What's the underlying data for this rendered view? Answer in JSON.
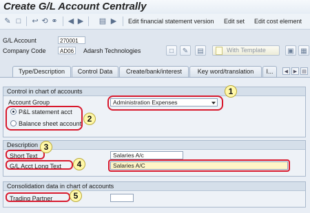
{
  "window": {
    "title": "Create G/L Account Centrally"
  },
  "toolbar": {
    "edit_fs_version": "Edit financial statement version",
    "edit_set": "Edit set",
    "edit_cost_element": "Edit cost element"
  },
  "header": {
    "gl_account_label": "G/L Account",
    "gl_account_value": "270001",
    "company_code_label": "Company Code",
    "company_code_value": "AD06",
    "company_name": "Adarsh Technologies",
    "with_template_label": "With Template"
  },
  "tabs": [
    {
      "label": "Type/Description",
      "active": true
    },
    {
      "label": "Control Data",
      "active": false
    },
    {
      "label": "Create/bank/interest",
      "active": false
    },
    {
      "label": "Key word/translation",
      "active": false
    },
    {
      "label": "I...",
      "active": false
    }
  ],
  "control_group": {
    "title": "Control in chart of accounts",
    "account_group_label": "Account Group",
    "account_group_value": "Administration Expenses",
    "pl_statement_label": "P&L statement acct",
    "balance_sheet_label": "Balance sheet account",
    "selected": "pl_statement"
  },
  "description_group": {
    "title": "Description",
    "short_text_label": "Short Text",
    "short_text_value": "Salaries A/c",
    "long_text_label": "G/L Acct Long Text",
    "long_text_value": "Salaries A/C"
  },
  "consolidation_group": {
    "title": "Consolidation data in chart of accounts",
    "trading_partner_label": "Trading Partner",
    "trading_partner_value": ""
  },
  "annotations": [
    "1",
    "2",
    "3",
    "4",
    "5"
  ],
  "colors": {
    "annotation_outline": "#d8182c",
    "badge_fill": "#fff8a8",
    "required_field": "#fff6c6"
  }
}
